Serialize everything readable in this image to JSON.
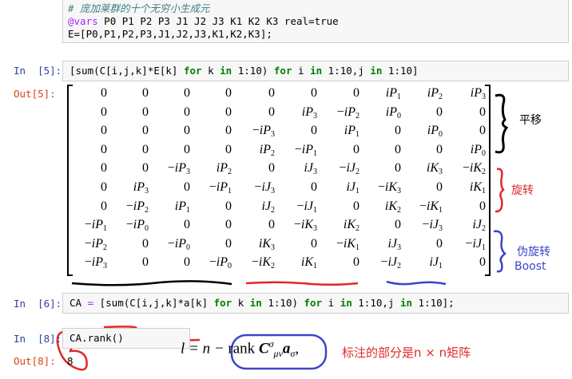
{
  "cell_top": {
    "comment": "# 庞加莱群的十个无穷小生成元",
    "line2_macro": "@vars",
    "line2_rest": " P0 P1 P2 P3 J1 J2 J3 K1 K2 K3 real=true",
    "line3": "E=[P0,P1,P2,P3,J1,J2,J3,K1,K2,K3];"
  },
  "cell5": {
    "in_prompt": "In  [5]:",
    "out_prompt": "Out[5]:",
    "code_a": "[sum(C[i,j,k]*E[k] ",
    "kw_for1": "for",
    "code_b": " k ",
    "kw_in1": "in",
    "code_c": " 1:10) ",
    "kw_for2": "for",
    "code_d": " i ",
    "kw_in2": "in",
    "code_e": " 1:10,j ",
    "kw_in3": "in",
    "code_f": " 1:10]"
  },
  "matrix": {
    "rows": [
      [
        "0",
        "0",
        "0",
        "0",
        "0",
        "0",
        "0",
        "iP1",
        "iP2",
        "iP3"
      ],
      [
        "0",
        "0",
        "0",
        "0",
        "0",
        "iP3",
        "−iP2",
        "iP0",
        "0",
        "0"
      ],
      [
        "0",
        "0",
        "0",
        "0",
        "−iP3",
        "0",
        "iP1",
        "0",
        "iP0",
        "0"
      ],
      [
        "0",
        "0",
        "0",
        "0",
        "iP2",
        "−iP1",
        "0",
        "0",
        "0",
        "iP0"
      ],
      [
        "0",
        "0",
        "−iP3",
        "iP2",
        "0",
        "iJ3",
        "−iJ2",
        "0",
        "iK3",
        "−iK2"
      ],
      [
        "0",
        "iP3",
        "0",
        "−iP1",
        "−iJ3",
        "0",
        "iJ1",
        "−iK3",
        "0",
        "iK1"
      ],
      [
        "0",
        "−iP2",
        "iP1",
        "0",
        "iJ2",
        "−iJ1",
        "0",
        "iK2",
        "−iK1",
        "0"
      ],
      [
        "−iP1",
        "−iP0",
        "0",
        "0",
        "0",
        "−iK3",
        "iK2",
        "0",
        "−iJ3",
        "iJ2"
      ],
      [
        "−iP2",
        "0",
        "−iP0",
        "0",
        "iK3",
        "0",
        "−iK1",
        "iJ3",
        "0",
        "−iJ1"
      ],
      [
        "−iP3",
        "0",
        "0",
        "−iP0",
        "−iK2",
        "iK1",
        "0",
        "−iJ2",
        "iJ1",
        "0"
      ]
    ]
  },
  "annotations": {
    "translation": "平移",
    "rotation": "旋转",
    "pseudo_rotation": "伪旋转",
    "boost": "Boost",
    "note": "标注的部分是n × n矩阵",
    "formula_lhs": "l = n −",
    "formula_rank": "rank",
    "formula_c": "C",
    "formula_sup": "σ",
    "formula_sub": "μν",
    "formula_a": "a",
    "formula_asub": "σ",
    "formula_comma": ",",
    "colors": {
      "black": "#000000",
      "red": "#e0282a",
      "blue": "#3b45c8"
    }
  },
  "cell6": {
    "in_prompt": "In  [6]:",
    "code_a": "CA ",
    "eq": "=",
    "code_b": " [sum(C[i,j,k]*a[k] ",
    "kw_for1": "for",
    "code_c": " k ",
    "kw_in1": "in",
    "code_d": " 1:10) ",
    "kw_for2": "for",
    "code_e": " i ",
    "kw_in2": "in",
    "code_f": " 1:10,j ",
    "kw_in3": "in",
    "code_g": " 1:10];"
  },
  "cell8": {
    "in_prompt": "In  [8]:",
    "out_prompt": "Out[8]:",
    "code": "CA.rank()",
    "output": "8"
  }
}
